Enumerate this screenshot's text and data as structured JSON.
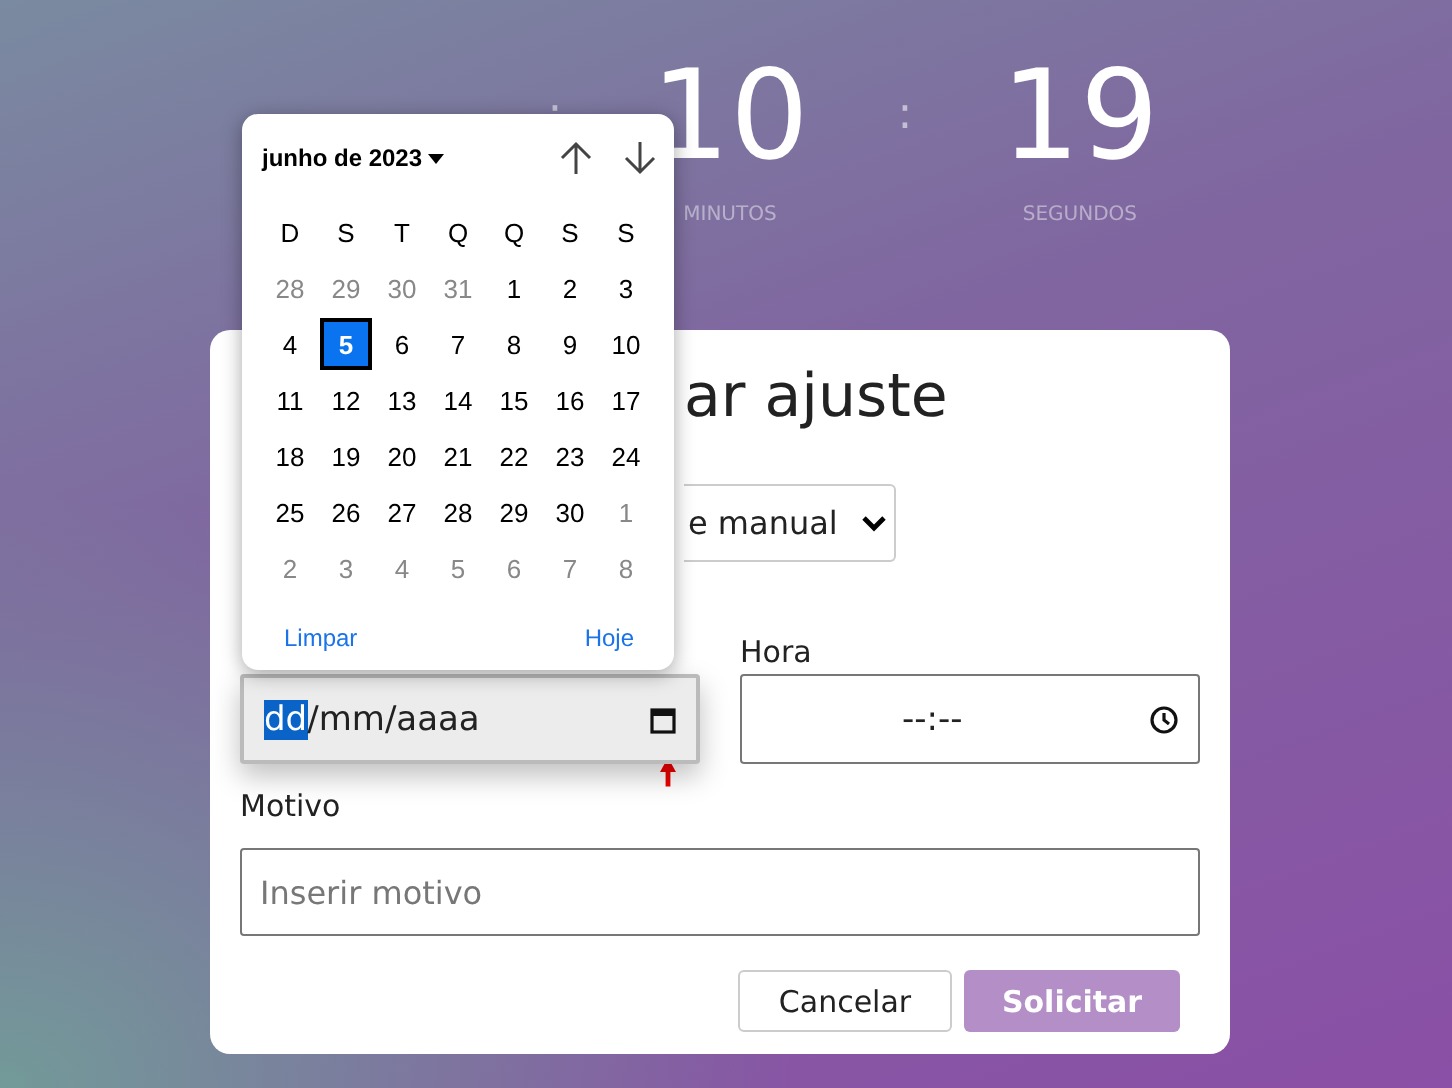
{
  "countdown": [
    {
      "value": "10",
      "label": "MINUTOS"
    },
    {
      "value": "19",
      "label": "SEGUNDOS"
    }
  ],
  "countdown_separators": [
    ":",
    ":"
  ],
  "card": {
    "title": "ar ajuste",
    "type_select": {
      "value": "e manual"
    },
    "date_field": {
      "day": "dd",
      "rest": "/mm/aaaa"
    },
    "time_label": "Hora",
    "time_field": {
      "value": "--:--"
    },
    "reason_label": "Motivo",
    "reason_field": {
      "placeholder": "Inserir motivo"
    },
    "buttons": [
      {
        "label": "Cancelar",
        "kind": "secondary"
      },
      {
        "label": "Solicitar",
        "kind": "primary"
      }
    ]
  },
  "calendar": {
    "month": "junho de 2023",
    "weekdays": [
      "D",
      "S",
      "T",
      "Q",
      "Q",
      "S",
      "S"
    ],
    "days": [
      {
        "label": "28",
        "outside": true,
        "selected": false
      },
      {
        "label": "29",
        "outside": true,
        "selected": false
      },
      {
        "label": "30",
        "outside": true,
        "selected": false
      },
      {
        "label": "31",
        "outside": true,
        "selected": false
      },
      {
        "label": "1",
        "outside": false,
        "selected": false
      },
      {
        "label": "2",
        "outside": false,
        "selected": false
      },
      {
        "label": "3",
        "outside": false,
        "selected": false
      },
      {
        "label": "4",
        "outside": false,
        "selected": false
      },
      {
        "label": "5",
        "outside": false,
        "selected": true
      },
      {
        "label": "6",
        "outside": false,
        "selected": false
      },
      {
        "label": "7",
        "outside": false,
        "selected": false
      },
      {
        "label": "8",
        "outside": false,
        "selected": false
      },
      {
        "label": "9",
        "outside": false,
        "selected": false
      },
      {
        "label": "10",
        "outside": false,
        "selected": false
      },
      {
        "label": "11",
        "outside": false,
        "selected": false
      },
      {
        "label": "12",
        "outside": false,
        "selected": false
      },
      {
        "label": "13",
        "outside": false,
        "selected": false
      },
      {
        "label": "14",
        "outside": false,
        "selected": false
      },
      {
        "label": "15",
        "outside": false,
        "selected": false
      },
      {
        "label": "16",
        "outside": false,
        "selected": false
      },
      {
        "label": "17",
        "outside": false,
        "selected": false
      },
      {
        "label": "18",
        "outside": false,
        "selected": false
      },
      {
        "label": "19",
        "outside": false,
        "selected": false
      },
      {
        "label": "20",
        "outside": false,
        "selected": false
      },
      {
        "label": "21",
        "outside": false,
        "selected": false
      },
      {
        "label": "22",
        "outside": false,
        "selected": false
      },
      {
        "label": "23",
        "outside": false,
        "selected": false
      },
      {
        "label": "24",
        "outside": false,
        "selected": false
      },
      {
        "label": "25",
        "outside": false,
        "selected": false
      },
      {
        "label": "26",
        "outside": false,
        "selected": false
      },
      {
        "label": "27",
        "outside": false,
        "selected": false
      },
      {
        "label": "28",
        "outside": false,
        "selected": false
      },
      {
        "label": "29",
        "outside": false,
        "selected": false
      },
      {
        "label": "30",
        "outside": false,
        "selected": false
      },
      {
        "label": "1",
        "outside": true,
        "selected": false
      },
      {
        "label": "2",
        "outside": true,
        "selected": false
      },
      {
        "label": "3",
        "outside": true,
        "selected": false
      },
      {
        "label": "4",
        "outside": true,
        "selected": false
      },
      {
        "label": "5",
        "outside": true,
        "selected": false
      },
      {
        "label": "6",
        "outside": true,
        "selected": false
      },
      {
        "label": "7",
        "outside": true,
        "selected": false
      },
      {
        "label": "8",
        "outside": true,
        "selected": false
      }
    ],
    "footer": [
      "Limpar",
      "Hoje"
    ]
  }
}
